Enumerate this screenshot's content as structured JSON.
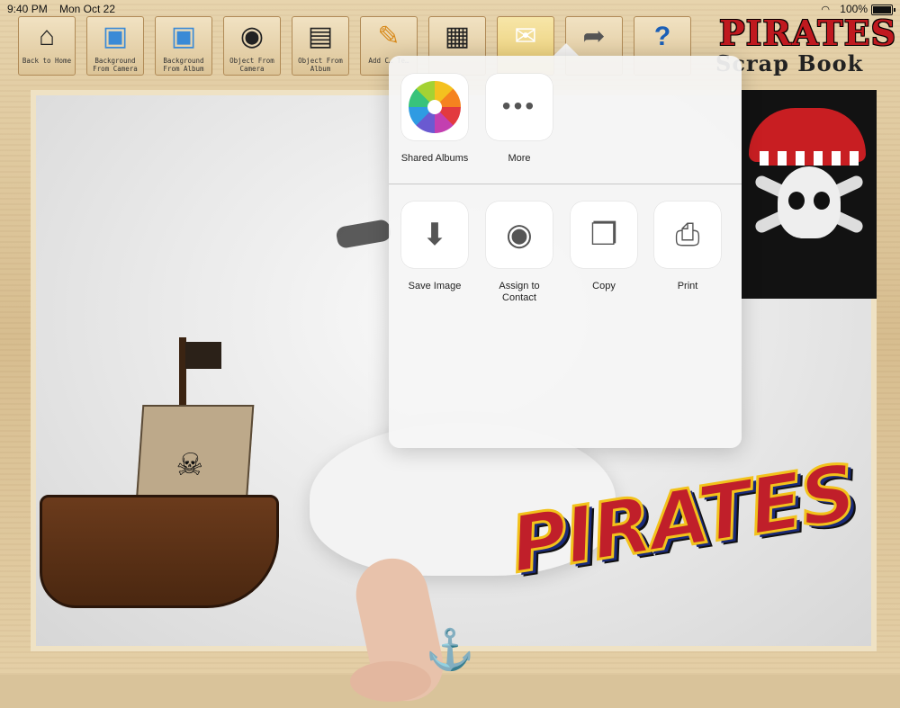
{
  "status_bar": {
    "time": "9:40 PM",
    "date": "Mon Oct 22",
    "battery": "100%"
  },
  "toolbar": [
    {
      "name": "back-to-home",
      "icon": "house-icon",
      "glyph": "⌂",
      "label": "Back to Home"
    },
    {
      "name": "background-from-camera",
      "icon": "photo-camera-icon",
      "glyph": "▣",
      "label": "Background From Camera"
    },
    {
      "name": "background-from-album",
      "icon": "photo-album-icon",
      "glyph": "▣",
      "label": "Background From Album"
    },
    {
      "name": "object-from-camera",
      "icon": "camera-icon",
      "glyph": "◉",
      "label": "Object From Camera"
    },
    {
      "name": "object-from-album",
      "icon": "film-album-icon",
      "glyph": "▤",
      "label": "Object From Album"
    },
    {
      "name": "add-text",
      "icon": "pencil-icon",
      "glyph": "✎",
      "label": "Add C… Te…"
    },
    {
      "name": "save",
      "icon": "floppy-disk-icon",
      "glyph": "▦",
      "label": ""
    },
    {
      "name": "email",
      "icon": "envelope-icon",
      "glyph": "✉",
      "label": ""
    },
    {
      "name": "share",
      "icon": "share-arrow-icon",
      "glyph": "➦",
      "label": ""
    },
    {
      "name": "help",
      "icon": "help-book-icon",
      "glyph": "?",
      "label": ""
    }
  ],
  "logo": {
    "line1": "PIRATES",
    "line2": "Scrap Book"
  },
  "canvas": {
    "word_art": "PIRATES"
  },
  "share_sheet": {
    "top_row": [
      {
        "name": "shared-albums",
        "label": "Shared Albums",
        "icon": "photos-icon"
      },
      {
        "name": "more",
        "label": "More",
        "icon": "more-dots-icon"
      }
    ],
    "actions": [
      {
        "name": "save-image",
        "label": "Save Image",
        "icon": "download-icon",
        "glyph": "⬇"
      },
      {
        "name": "assign-to-contact",
        "label": "Assign to Contact",
        "icon": "contact-icon",
        "glyph": "◉"
      },
      {
        "name": "copy",
        "label": "Copy",
        "icon": "copy-icon",
        "glyph": "❐"
      },
      {
        "name": "print",
        "label": "Print",
        "icon": "printer-icon",
        "glyph": "⎙"
      }
    ]
  }
}
